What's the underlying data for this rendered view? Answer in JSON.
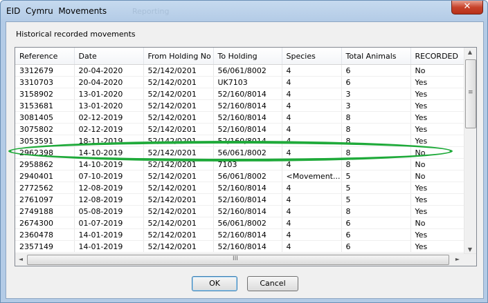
{
  "window": {
    "title": "EID  Cymru  Movements",
    "ghost_title": "Reporting",
    "close_symbol": "✕"
  },
  "group": {
    "label": "Historical recorded movements"
  },
  "table": {
    "columns": [
      "Reference",
      "Date",
      "From Holding No",
      "To Holding",
      "Species",
      "Total Animals",
      "RECORDED"
    ],
    "rows": [
      [
        "3312679",
        "20-04-2020",
        "52/142/0201",
        "56/061/8002",
        "4",
        "6",
        "No"
      ],
      [
        "3310703",
        "20-04-2020",
        "52/142/0201",
        "UK7103",
        "4",
        "6",
        "Yes"
      ],
      [
        "3158902",
        "13-01-2020",
        "52/142/0201",
        "52/160/8014",
        "4",
        "3",
        "Yes"
      ],
      [
        "3153681",
        "13-01-2020",
        "52/142/0201",
        "52/160/8014",
        "4",
        "3",
        "Yes"
      ],
      [
        "3081405",
        "02-12-2019",
        "52/142/0201",
        "52/160/8014",
        "4",
        "8",
        "Yes"
      ],
      [
        "3075802",
        "02-12-2019",
        "52/142/0201",
        "52/160/8014",
        "4",
        "8",
        "Yes"
      ],
      [
        "3053591",
        "18-11-2019",
        "52/142/0201",
        "52/160/8014",
        "4",
        "8",
        "Yes"
      ],
      [
        "2962398",
        "14-10-2019",
        "52/142/0201",
        "56/061/8002",
        "4",
        "8",
        "No"
      ],
      [
        "2958862",
        "14-10-2019",
        "52/142/0201",
        "7103",
        "4",
        "8",
        "No"
      ],
      [
        "2940401",
        "07-10-2019",
        "52/142/0201",
        "56/061/8002",
        "<Movement...",
        "5",
        "No"
      ],
      [
        "2772562",
        "12-08-2019",
        "52/142/0201",
        "52/160/8014",
        "4",
        "5",
        "Yes"
      ],
      [
        "2761097",
        "12-08-2019",
        "52/142/0201",
        "52/160/8014",
        "4",
        "5",
        "Yes"
      ],
      [
        "2749188",
        "05-08-2019",
        "52/142/0201",
        "52/160/8014",
        "4",
        "8",
        "Yes"
      ],
      [
        "2674300",
        "01-07-2019",
        "52/142/0201",
        "56/061/8002",
        "4",
        "6",
        "No"
      ],
      [
        "2360478",
        "14-01-2019",
        "52/142/0201",
        "52/160/8014",
        "4",
        "6",
        "Yes"
      ],
      [
        "2357149",
        "14-01-2019",
        "52/142/0201",
        "52/160/8014",
        "4",
        "6",
        "Yes"
      ]
    ]
  },
  "buttons": {
    "ok": "OK",
    "cancel": "Cancel"
  },
  "scroll": {
    "up": "▲",
    "down": "▼",
    "left": "◄",
    "right": "►",
    "grip_v": "≡",
    "grip_h": "III"
  },
  "annotation": {
    "highlighted_row_reference": "2962398",
    "color": "#1faa3a"
  }
}
